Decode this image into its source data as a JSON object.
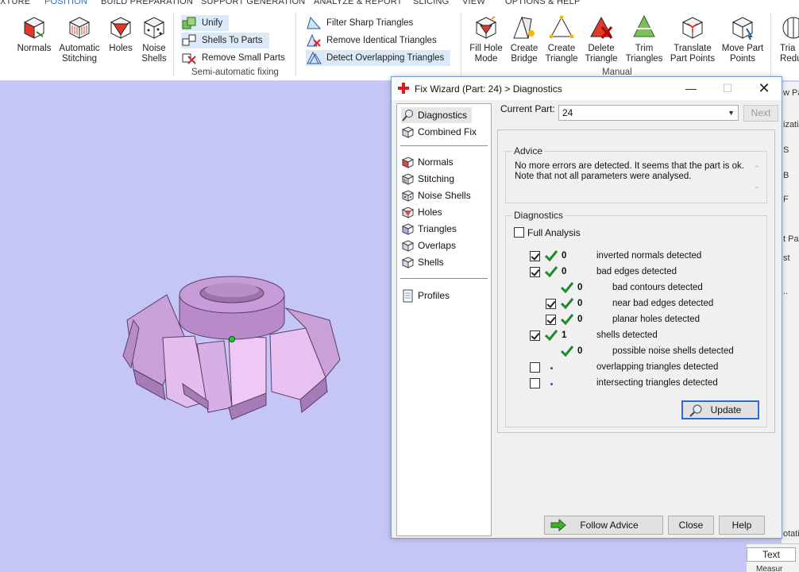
{
  "menu": {
    "items": [
      {
        "label": "XTURE",
        "active": false
      },
      {
        "label": "POSITION",
        "active": true
      },
      {
        "label": "BUILD PREPARATION",
        "active": false
      },
      {
        "label": "SUPPORT GENERATION",
        "active": false
      },
      {
        "label": "ANALYZE & REPORT",
        "active": false
      },
      {
        "label": "SLICING",
        "active": false
      },
      {
        "label": "VIEW",
        "active": false
      },
      {
        "label": "OPTIONS & HELP",
        "active": false
      }
    ]
  },
  "ribbon": {
    "normals": "Normals",
    "auto_stitch_1": "Automatic",
    "auto_stitch_2": "Stitching",
    "holes": "Holes",
    "noise_1": "Noise",
    "noise_2": "Shells",
    "unify": "Unify",
    "shells_to_parts": "Shells To Parts",
    "remove_small_parts": "Remove Small Parts",
    "semi_auto_label": "Semi-automatic fixing",
    "filter_sharp": "Filter Sharp Triangles",
    "remove_identical": "Remove Identical Triangles",
    "detect_overlap": "Detect Overlapping Triangles",
    "fill_hole_1": "Fill Hole",
    "fill_hole_2": "Mode",
    "create_bridge_1": "Create",
    "create_bridge_2": "Bridge",
    "create_triangle_1": "Create",
    "create_triangle_2": "Triangle",
    "delete_triangle_1": "Delete",
    "delete_triangle_2": "Triangle",
    "trim_triangles_1": "Trim",
    "trim_triangles_2": "Triangles",
    "translate_points_1": "Translate",
    "translate_points_2": "Part Points",
    "move_points_1": "Move Part",
    "move_points_2": "Points",
    "tria_1": "Tria",
    "tria_2": "Redu",
    "manual_label": "Manual"
  },
  "right_strip": {
    "frag1": "w Pa",
    "frag2": "izati",
    "frag3": "S",
    "frag4": "B",
    "frag5": "F",
    "frag6": "t Pa",
    "frag7": "st",
    "frag8": "..",
    "frag9": "otati",
    "text_button": "Text",
    "measure": "Measur"
  },
  "dialog": {
    "title": "Fix Wizard (Part: 24) > Diagnostics",
    "nav": {
      "diagnostics": "Diagnostics",
      "combined_fix": "Combined Fix",
      "normals": "Normals",
      "stitching": "Stitching",
      "noise_shells": "Noise Shells",
      "holes": "Holes",
      "triangles": "Triangles",
      "overlaps": "Overlaps",
      "shells": "Shells",
      "profiles": "Profiles"
    },
    "current_part_label": "Current Part:",
    "current_part_value": "24",
    "next_button": "Next",
    "advice_legend": "Advice",
    "advice_text": "No more errors are detected. It seems that the part is ok. Note that not all parameters were analysed.",
    "diagnostics_legend": "Diagnostics",
    "full_analysis": "Full Analysis",
    "rows": [
      {
        "count": "0",
        "label": "inverted normals detected"
      },
      {
        "count": "0",
        "label": "bad edges detected"
      },
      {
        "count": "0",
        "label": "bad contours detected"
      },
      {
        "count": "0",
        "label": "near bad edges detected"
      },
      {
        "count": "0",
        "label": "planar holes detected"
      },
      {
        "count": "1",
        "label": "shells detected"
      },
      {
        "count": "0",
        "label": "possible noise shells detected"
      },
      {
        "count": "",
        "label": "overlapping triangles detected"
      },
      {
        "count": "",
        "label": "intersecting triangles detected"
      }
    ],
    "update_button": "Update",
    "follow_advice_button": "Follow Advice",
    "close_button": "Close",
    "help_button": "Help"
  },
  "colors": {
    "viewport_bg": "#c5c6f5",
    "part_color": "#c9a0d8",
    "accent": "#2d6bcf",
    "check_green": "#1e8a2c"
  }
}
